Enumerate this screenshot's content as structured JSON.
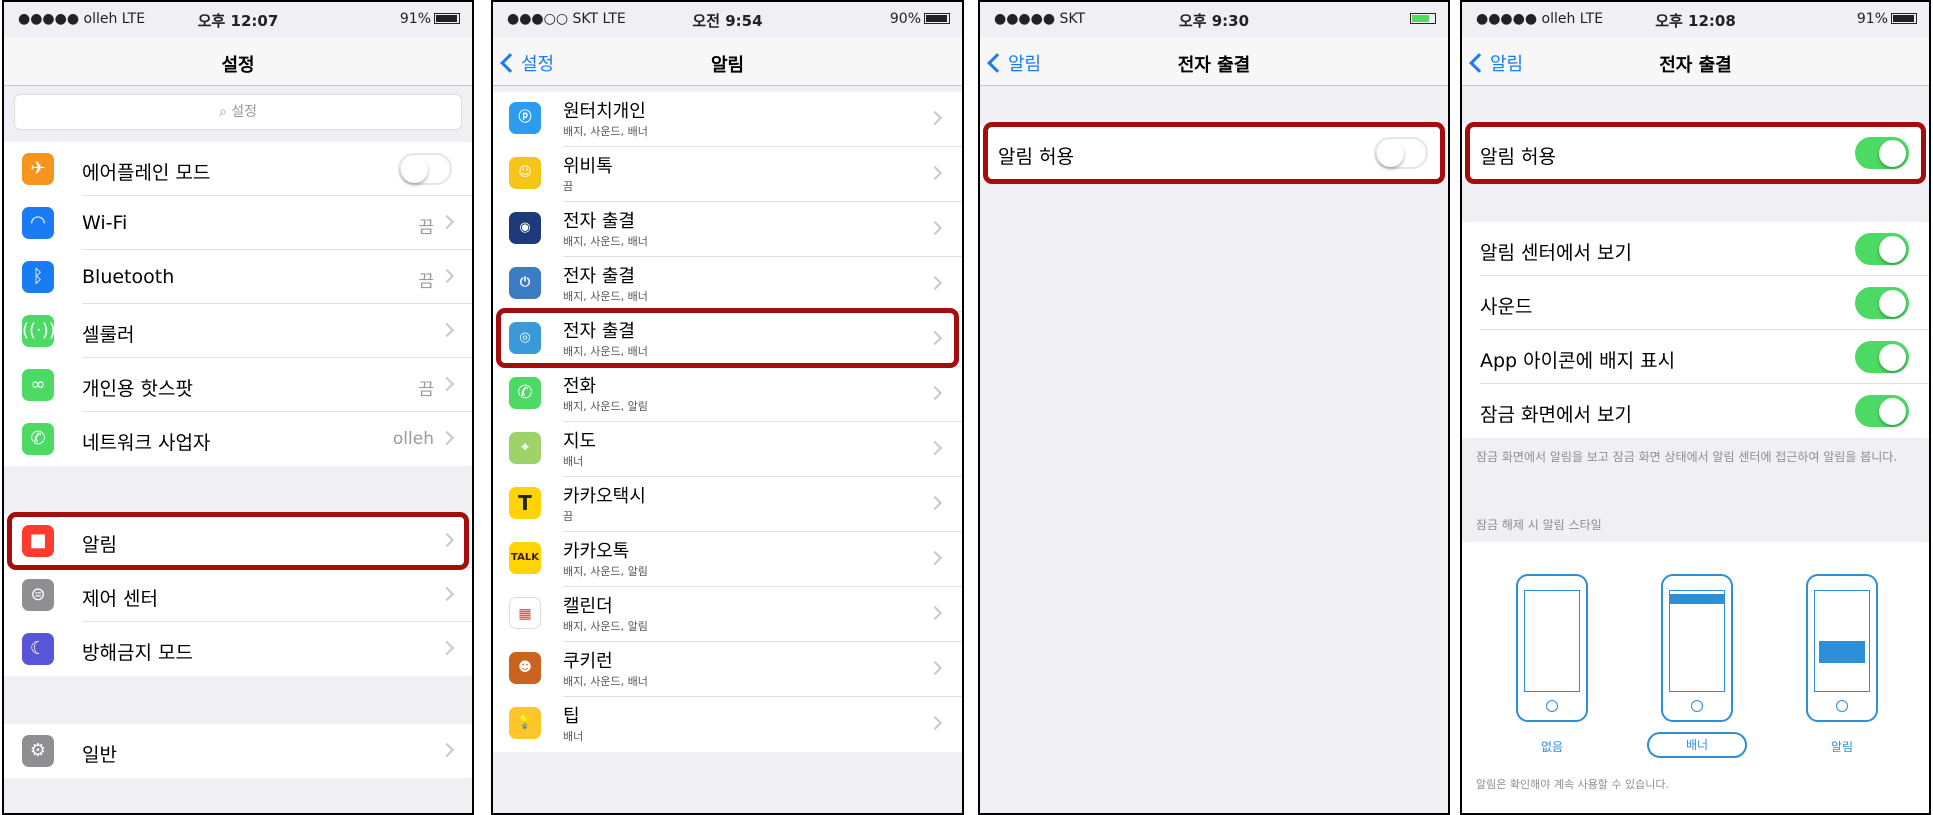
{
  "colors": {
    "accent": "#1a7cf5",
    "toggle_on": "#4cd964",
    "highlight": "#a50d0d"
  },
  "screen1": {
    "status": {
      "carrier": "●●●●● olleh  LTE",
      "time": "오후 12:07",
      "battery": "91%"
    },
    "title": "설정",
    "search_placeholder": "설정",
    "rows": [
      {
        "label": "에어플레인 모드",
        "icon": "airplane-icon",
        "value": ""
      },
      {
        "label": "Wi-Fi",
        "icon": "wifi-icon",
        "value": "끔"
      },
      {
        "label": "Bluetooth",
        "icon": "bluetooth-icon",
        "value": "끔"
      },
      {
        "label": "셀룰러",
        "icon": "cellular-icon",
        "value": ""
      },
      {
        "label": "개인용 핫스팟",
        "icon": "hotspot-icon",
        "value": "끔"
      },
      {
        "label": "네트워크 사업자",
        "icon": "phone-icon",
        "value": "olleh"
      },
      {
        "label": "알림",
        "icon": "notifications-icon",
        "value": ""
      },
      {
        "label": "제어 센터",
        "icon": "control-center-icon",
        "value": ""
      },
      {
        "label": "방해금지 모드",
        "icon": "moon-icon",
        "value": ""
      },
      {
        "label": "일반",
        "icon": "gear-icon",
        "value": ""
      }
    ]
  },
  "screen2": {
    "status": {
      "carrier": "●●●○○ SKT  LTE",
      "time": "오전 9:54",
      "battery": "90%"
    },
    "back": "설정",
    "title": "알림",
    "apps": [
      {
        "name": "원터치개인",
        "sub": "배지, 사운드, 배너"
      },
      {
        "name": "위비톡",
        "sub": "끔"
      },
      {
        "name": "전자 출결",
        "sub": "배지, 사운드, 배너"
      },
      {
        "name": "전자 출결",
        "sub": "배지, 사운드, 배너"
      },
      {
        "name": "전자 출결",
        "sub": "배지, 사운드, 배너"
      },
      {
        "name": "전화",
        "sub": "배지, 사운드, 알림"
      },
      {
        "name": "지도",
        "sub": "배너"
      },
      {
        "name": "카카오택시",
        "sub": "끔"
      },
      {
        "name": "카카오톡",
        "sub": "배지, 사운드, 알림"
      },
      {
        "name": "캘린더",
        "sub": "배지, 사운드, 알림"
      },
      {
        "name": "쿠키런",
        "sub": "배지, 사운드, 배너"
      },
      {
        "name": "팁",
        "sub": "배너"
      }
    ],
    "icon_text": {
      "kakaotalk": "TALK",
      "kakaotaxi": "T"
    }
  },
  "screen3": {
    "status": {
      "carrier": "●●●●● SKT",
      "time": "오후 9:30",
      "battery": ""
    },
    "back": "알림",
    "title": "전자 출결",
    "allow_label": "알림 허용",
    "allow_on": false
  },
  "screen4": {
    "status": {
      "carrier": "●●●●● olleh  LTE",
      "time": "오후 12:08",
      "battery": "91%"
    },
    "back": "알림",
    "title": "전자 출결",
    "allow_label": "알림 허용",
    "rows": [
      {
        "label": "알림 센터에서 보기",
        "on": true
      },
      {
        "label": "사운드",
        "on": true
      },
      {
        "label": "App 아이콘에 배지 표시",
        "on": true
      },
      {
        "label": "잠금 화면에서 보기",
        "on": true
      }
    ],
    "lock_footer": "잠금 화면에서 알림을 보고 잠금 화면 상태에서 알림 센터에 접근하여 알림을 봅니다.",
    "style_header": "잠금 해제 시 알림 스타일",
    "styles": [
      "없음",
      "배너",
      "알림"
    ],
    "selected_style": "배너",
    "bottom_footer": "알림은 확인해야 계속 사용할 수 있습니다."
  }
}
